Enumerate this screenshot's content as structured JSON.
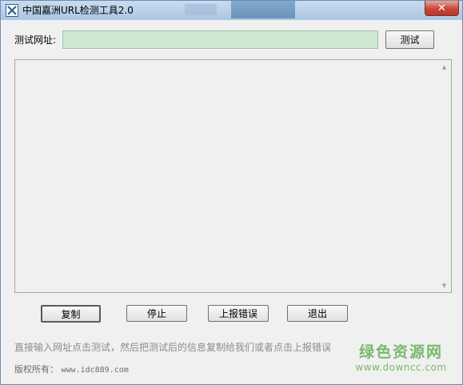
{
  "window": {
    "title": "中国嘉洲URL检测工具2.0",
    "close_glyph": "✕"
  },
  "url_row": {
    "label": "测试网址:",
    "input_value": "",
    "test_button": "测试"
  },
  "output": {
    "content": ""
  },
  "actions": {
    "copy": "复制",
    "stop": "停止",
    "report": "上报错误",
    "exit": "退出"
  },
  "footer": {
    "hint": "直接输入网址点击测试，然后把测试后的信息复制给我们或者点击上报错误",
    "copyright_label": "版权所有：",
    "copyright_url": "www.idc889.com"
  },
  "watermark": {
    "title": "绿色资源网",
    "url": "www.downcc.com"
  },
  "colors": {
    "input_bg": "#cfe8d2",
    "window_bg": "#f0f0f0",
    "watermark": "#7ab96a",
    "close_button": "#c9473a"
  },
  "icons": {
    "app": "app-x-icon",
    "close": "close-icon",
    "scroll_up": "scroll-up-arrow-icon",
    "scroll_down": "scroll-down-arrow-icon"
  }
}
